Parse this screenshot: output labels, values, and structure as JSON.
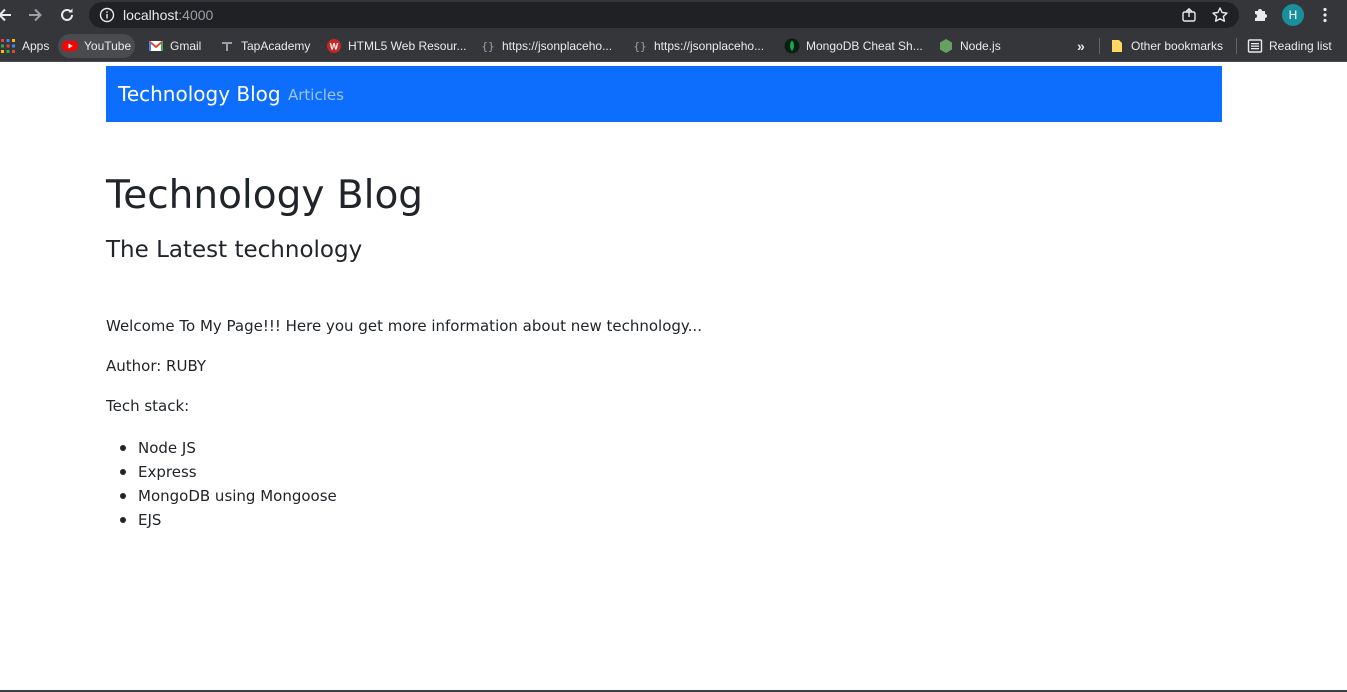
{
  "browser": {
    "url_host": "localhost",
    "url_port": ":4000",
    "profile_initial": "H",
    "bookmarks": [
      {
        "label": "Apps"
      },
      {
        "label": "YouTube"
      },
      {
        "label": "Gmail"
      },
      {
        "label": "TapAcademy"
      },
      {
        "label": "HTML5 Web Resour..."
      },
      {
        "label": "https://jsonplaceho..."
      },
      {
        "label": "https://jsonplaceho..."
      },
      {
        "label": "MongoDB Cheat Sh..."
      },
      {
        "label": "Node.js"
      }
    ],
    "overflow_label": "»",
    "other_bookmarks": "Other bookmarks",
    "reading_list": "Reading list"
  },
  "navbar": {
    "brand": "Technology Blog",
    "link": "Articles",
    "color": "#0d6efd"
  },
  "main": {
    "title": "Technology Blog",
    "subtitle": "The Latest technology",
    "welcome": "Welcome To My Page!!! Here you get more information about new technology...",
    "author": "Author: RUBY",
    "tech_stack_label": "Tech stack:",
    "tech_stack": [
      "Node JS",
      "Express",
      "MongoDB using Mongoose",
      "EJS"
    ]
  }
}
